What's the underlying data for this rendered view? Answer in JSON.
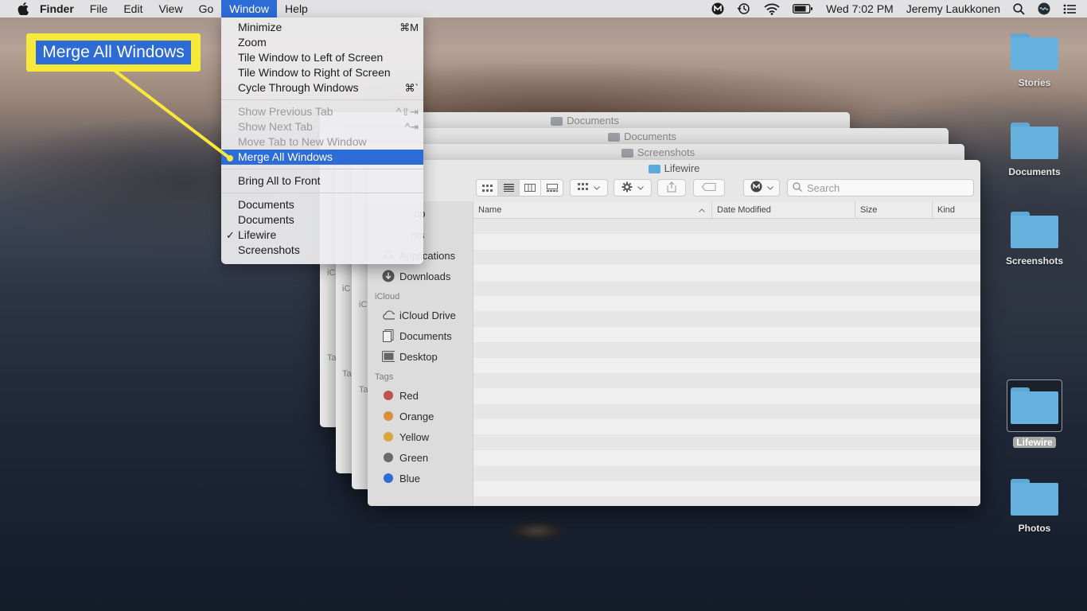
{
  "menubar": {
    "app_name": "Finder",
    "items": [
      "File",
      "Edit",
      "View",
      "Go",
      "Window",
      "Help"
    ],
    "active_item": "Window",
    "clock": "Wed 7:02 PM",
    "user": "Jeremy Laukkonen"
  },
  "window_menu": {
    "group1": [
      {
        "label": "Minimize",
        "shortcut": "⌘M"
      },
      {
        "label": "Zoom",
        "shortcut": ""
      },
      {
        "label": "Tile Window to Left of Screen",
        "shortcut": ""
      },
      {
        "label": "Tile Window to Right of Screen",
        "shortcut": ""
      },
      {
        "label": "Cycle Through Windows",
        "shortcut": "⌘`"
      }
    ],
    "group2": [
      {
        "label": "Show Previous Tab",
        "shortcut": "^⇧⇥"
      },
      {
        "label": "Show Next Tab",
        "shortcut": "^⇥"
      },
      {
        "label": "Move Tab to New Window",
        "shortcut": ""
      },
      {
        "label": "Merge All Windows",
        "shortcut": ""
      }
    ],
    "group3": [
      {
        "label": "Bring All to Front"
      }
    ],
    "group4": [
      {
        "label": "Documents",
        "checked": false
      },
      {
        "label": "Documents",
        "checked": false
      },
      {
        "label": "Lifewire",
        "checked": true
      },
      {
        "label": "Screenshots",
        "checked": false
      }
    ],
    "check_mark": "✓"
  },
  "callout": {
    "label": "Merge All Windows",
    "color": "#f7e93a"
  },
  "stacked_windows": [
    {
      "title": "Documents"
    },
    {
      "title": "Documents"
    },
    {
      "title": "Screenshots"
    }
  ],
  "stub_labels": {
    "icloud": "iC",
    "tags": "Ta"
  },
  "finder": {
    "title": "Lifewire",
    "search_placeholder": "Search",
    "sidebar_partial": [
      "op",
      "nts"
    ],
    "sidebar_favorites": [
      {
        "label": "Applications",
        "icon": "applications-icon"
      },
      {
        "label": "Downloads",
        "icon": "downloads-icon"
      }
    ],
    "icloud_header": "iCloud",
    "sidebar_icloud": [
      {
        "label": "iCloud Drive",
        "icon": "cloud-icon"
      },
      {
        "label": "Documents",
        "icon": "documents-icon"
      },
      {
        "label": "Desktop",
        "icon": "desktop-icon"
      }
    ],
    "tags_header": "Tags",
    "tags": [
      {
        "label": "Red",
        "color": "#c0504a"
      },
      {
        "label": "Orange",
        "color": "#d8913a"
      },
      {
        "label": "Yellow",
        "color": "#d8a53a"
      },
      {
        "label": "Green",
        "color": "#6a6a6a"
      },
      {
        "label": "Blue",
        "color": "#2d6bd6"
      }
    ],
    "columns": [
      "Name",
      "Date Modified",
      "Size",
      "Kind"
    ]
  },
  "desktop_icons": [
    {
      "label": "Stories",
      "selected": false
    },
    {
      "label": "Documents",
      "selected": false
    },
    {
      "label": "Screenshots",
      "selected": false
    },
    {
      "label": "Lifewire",
      "selected": true
    },
    {
      "label": "Photos",
      "selected": false
    }
  ]
}
